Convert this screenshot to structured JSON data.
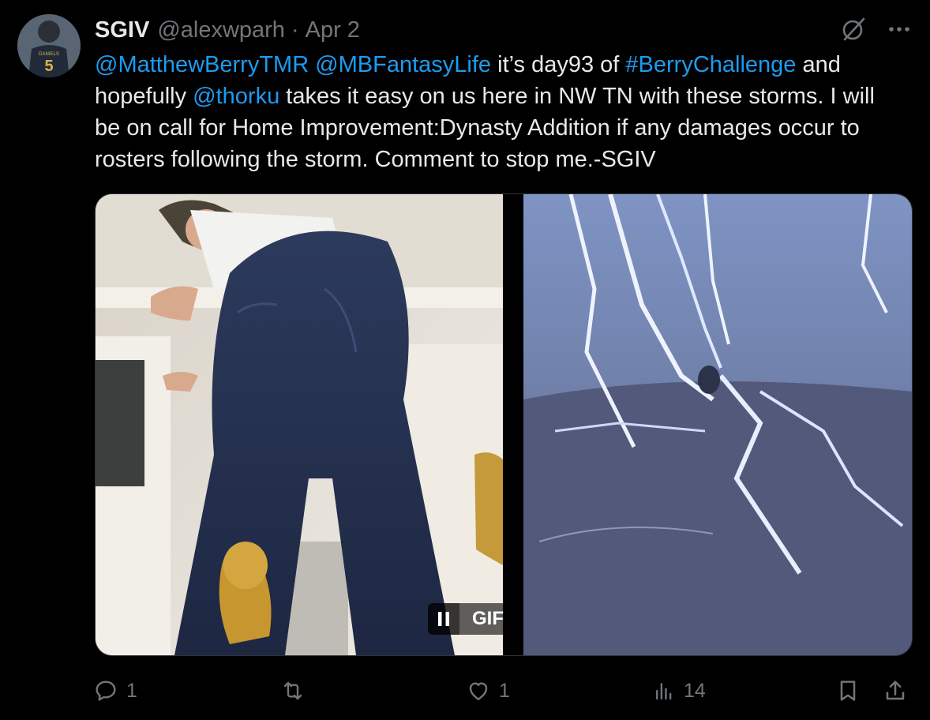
{
  "tweet": {
    "author_name": "SGIV",
    "author_handle": "@alexwparh",
    "separator": "·",
    "date": "Apr 2",
    "text_parts": [
      {
        "t": "@MatthewBerryTMR",
        "link": true
      },
      {
        "t": " ",
        "link": false
      },
      {
        "t": "@MBFantasyLife",
        "link": true
      },
      {
        "t": " it’s day93 of ",
        "link": false
      },
      {
        "t": "#BerryChallenge",
        "link": true
      },
      {
        "t": " and hopefully ",
        "link": false
      },
      {
        "t": "@thorku",
        "link": true
      },
      {
        "t": " takes it easy on us here in NW TN with these storms. I will be on call for Home Improvement:Dynasty Addition if any damages occur to rosters following the storm. Comment to stop me.-SGIV",
        "link": false
      }
    ],
    "avatar_jersey_name": "DANIELS",
    "avatar_jersey_number": "5"
  },
  "media": {
    "left_image": "man on ladder in jeans painting doorframe",
    "right_image": "lightning storm gif",
    "gif_label": "GIF",
    "gif_state_icon": "pause-icon"
  },
  "actions": {
    "replies": "1",
    "reposts": "",
    "likes": "1",
    "views": "14"
  },
  "colors": {
    "background": "#000000",
    "text": "#e7e9ea",
    "muted": "#71767b",
    "link": "#1d9bf0"
  }
}
